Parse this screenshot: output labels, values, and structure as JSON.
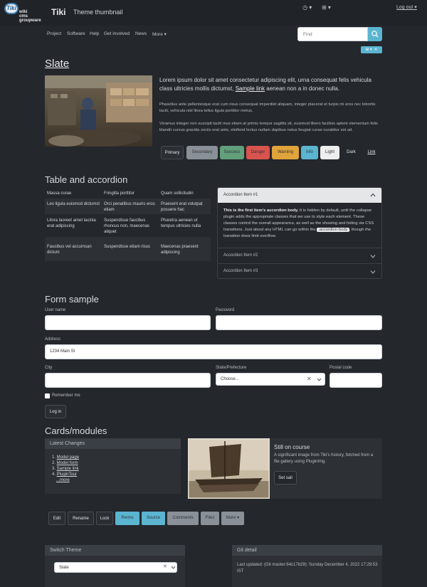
{
  "header": {
    "logo_mark": "Tiki",
    "logo_sub": [
      "wiki",
      "cms",
      "groupware"
    ],
    "site_name": "Tiki",
    "site_slogan": "Theme thumbnail",
    "logout": "Log out"
  },
  "nav": {
    "items": [
      "Project",
      "Software",
      "Help",
      "Get involved",
      "News",
      "More ▾"
    ],
    "search_placeholder": "Find"
  },
  "slate": {
    "title": "Slate",
    "lead_pre": "Lorem ipsum dolor sit amet consectetur adipiscing elit, urna consequat felis vehicula class ultricies mollis dictumst, ",
    "lead_link": "Sample link",
    "lead_post": " aenean non a in donec nulla.",
    "para1": "Phasellus ante pellentesque erat cum risus consequat imperdiet aliquam, integer placerat et turpis mi eros nec lobortis taciti, vehicula nisl litora tellus ligula porttitor metus.",
    "para2": "Vivamus integer non suscipit taciti mus etiam at primis tempor sagittis sit, euismod libero facilisis aptent elementum felis blandit cursus gravida sociis erat ante, eleifend lectus nullam dapibus netus feugiat curae curabitur est ad.",
    "buttons": [
      "Primary",
      "Secondary",
      "Success",
      "Danger",
      "Warning",
      "Info",
      "Light",
      "Dark",
      "Link"
    ]
  },
  "table_section": {
    "title": "Table and accordion",
    "rows": [
      [
        "Massa curae",
        "Fringilla porttitor",
        "Quam sollicitudin"
      ],
      [
        "Leo ligula euismod dictumst",
        "Orci penatibus mauris eros etiam",
        "Praesent erat volutpat posuere hac"
      ],
      [
        "Litora laoreet amet lacinia erat adipiscing",
        "Suspendisse faucibus rhoncus non, maecenas aliquet",
        "Pharetra aenean ut tempus ultricies nulla"
      ],
      [
        "Faucibus vel accumsan dictum",
        "Suspendisse etiam risus",
        "Maecenas praesent adipiscing"
      ]
    ],
    "accordion": {
      "item1": "Accordion Item #1",
      "body_bold": "This is the first item's accordion body.",
      "body_text": " It is hidden by default, until the collapse plugin adds the appropriate classes that we use to style each element. These classes control the overall appearance, as well as the showing and hiding via CSS transitions. Just about any HTML can go within the ",
      "body_code": ".accordion-body",
      "body_end": ", though the transition does limit overflow.",
      "item2": "Accordion Item #2",
      "item3": "Accordion Item #3"
    }
  },
  "form": {
    "title": "Form sample",
    "username_label": "User name",
    "password_label": "Password",
    "address_label": "Address",
    "address_value": "1234 Main St",
    "city_label": "City",
    "state_label": "State/Prefecture",
    "state_value": "Choose...",
    "postal_label": "Postal code",
    "remember_label": "Remember me",
    "login_button": "Log in"
  },
  "cards": {
    "title": "Cards/modules",
    "latest_changes": {
      "heading": "Latest Changes",
      "items": [
        "Model page",
        "Model form",
        "Sample link",
        "PluginTour"
      ],
      "more": "...more"
    },
    "still_on_course": {
      "title": "Still on course",
      "text": "A significant image from Tiki's history, fetched from a file gallery using PluginImg.",
      "button": "Set sail"
    }
  },
  "page_tools": [
    "Edit",
    "Rename",
    "Lock",
    "Perms",
    "Source",
    "Comments",
    "Files",
    "More ▾"
  ],
  "switch_theme": {
    "heading": "Switch Theme",
    "value": "Slate"
  },
  "git_detail": {
    "heading": "Git detail",
    "text": "Last updated: (Git master:64c17b29): Sunday December 4, 2022 17:29:53 IST"
  },
  "colors": {
    "background": "#24272c",
    "info": "#5bb5d1",
    "success": "#62a07b",
    "danger": "#d9534f",
    "warning": "#e0a43a"
  }
}
